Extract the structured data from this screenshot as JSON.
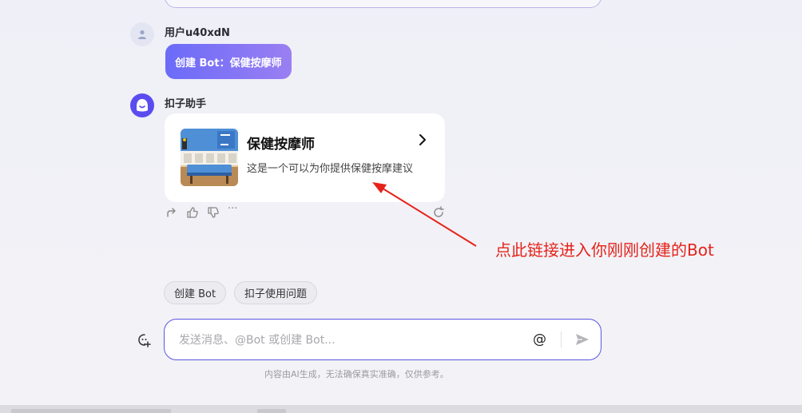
{
  "conversation": {
    "user": {
      "name": "用户u40xdN",
      "message": "创建 Bot：保健按摩师"
    },
    "assistant": {
      "name": "扣子助手",
      "bot_card": {
        "title": "保健按摩师",
        "description": "这是一个可以为你提供保健按摩建议"
      }
    },
    "actions": {
      "share_icon": "share-icon",
      "like_icon": "thumbs-up-icon",
      "dislike_icon": "thumbs-down-icon",
      "more_label": "···",
      "regenerate_icon": "refresh-icon"
    }
  },
  "annotation": {
    "text": "点此链接进入你刚刚创建的Bot",
    "color": "#e5231a"
  },
  "suggestions": [
    {
      "label": "创建 Bot"
    },
    {
      "label": "扣子使用问题"
    }
  ],
  "composer": {
    "placeholder": "发送消息、@Bot 或创建 Bot...",
    "value": "",
    "at_label": "@"
  },
  "disclaimer": "内容由AI生成，无法确保真实准确，仅供参考。",
  "colors": {
    "accent": "#5b55e0",
    "user_bubble_start": "#6b6bf8",
    "user_bubble_end": "#9a7ff2",
    "bot_avatar": "#5b4cf0"
  }
}
